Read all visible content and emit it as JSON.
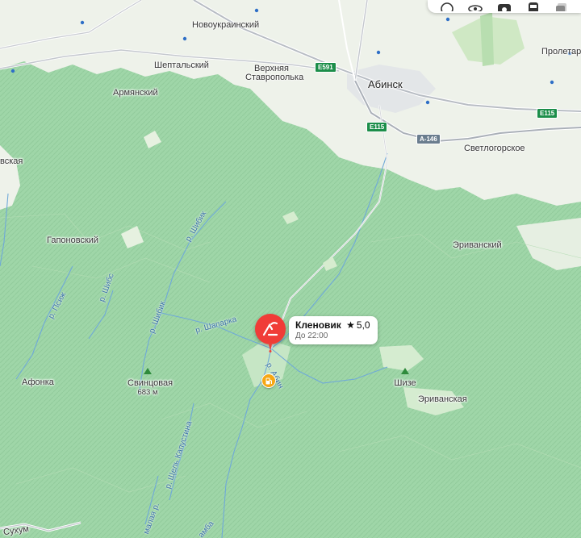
{
  "places": {
    "novoukrainsky": "Новоукраинский",
    "sheptalsky": "Шептальский",
    "verkhnyaya": "Верхняя",
    "stavropolka": "Ставрополька",
    "armyansky": "Армянский",
    "abinsk": "Абинск",
    "proletar": "Пролетар",
    "svetlogorskoe": "Светлогорское",
    "vskaya": "вская",
    "gaponovsky": "Гапоновский",
    "erivansky": "Эриванский",
    "afonka": "Афонка",
    "erivanskaya": "Эриванская",
    "sukhum": "Сухум"
  },
  "rivers": {
    "shibik1": "р. Шибик",
    "shibik2": "р. Шибик",
    "shapark": "р. Шапарка",
    "psizh": "р. Псиж",
    "shibs": "р. Шибс",
    "abin": "р. Абин",
    "tschel": "р. Щель Капустина",
    "malaya": "малая р.",
    "amba": "амба"
  },
  "roads": {
    "e591": "E591",
    "e115a": "E115",
    "e115b": "E115",
    "a146": "A-146"
  },
  "peaks": {
    "svintsovaya": {
      "name": "Свинцовая",
      "elev": "683 м"
    },
    "shize": {
      "name": "Шизе"
    }
  },
  "place_card": {
    "name": "Кленовик",
    "star": "★",
    "rating": "5,0",
    "hours": "До 22:00"
  },
  "colors": {
    "forest": "#a9ddb1",
    "open_land": "#eef3ea",
    "pin": "#f03c37",
    "poi": "#f6a714",
    "road_shield": "#1c8e4a"
  },
  "icons": {
    "toolbar": [
      "circle-icon",
      "panorama-icon",
      "camera-icon",
      "transit-icon",
      "layers-icon"
    ],
    "pin": "recreation-icon",
    "poi": "fuel-icon",
    "peak": "mountain-icon"
  }
}
